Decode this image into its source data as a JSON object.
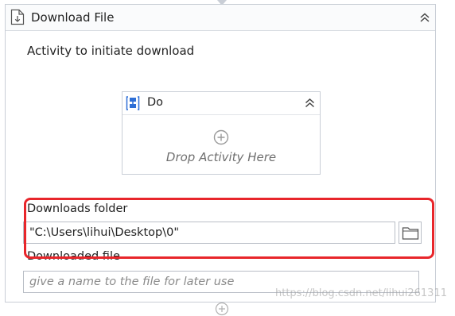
{
  "activity": {
    "title": "Download File",
    "icon": "file-download-icon",
    "section_label": "Activity to initiate download"
  },
  "do_container": {
    "title": "Do",
    "icon": "sequence-icon",
    "drop_hint": "Drop Activity Here"
  },
  "properties": {
    "downloads_folder_label": "Downloads folder",
    "downloads_folder_value": "\"C:\\Users\\lihui\\Desktop\\0\"",
    "downloaded_file_label": "Downloaded file",
    "downloaded_file_placeholder": "give a name to the file for later use"
  },
  "watermark": "https://blog.csdn.net/lihui261311",
  "colors": {
    "highlight": "#e8262b",
    "border": "#c9ced6",
    "placeholder": "#8a8a8a",
    "icon_blue": "#2e6fd6"
  }
}
